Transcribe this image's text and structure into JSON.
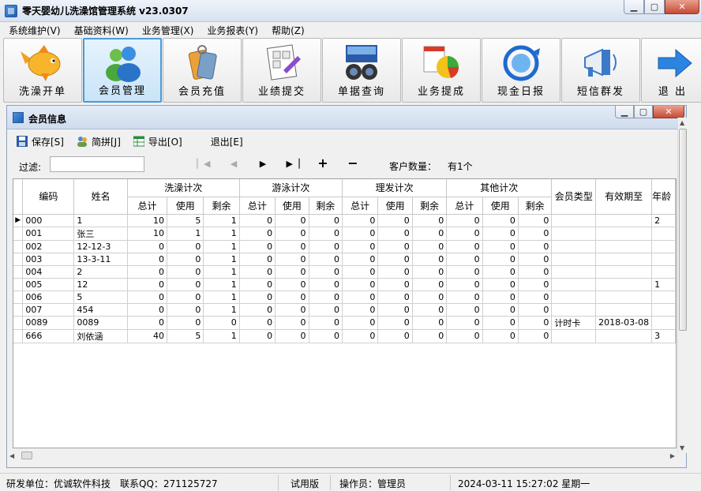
{
  "window": {
    "title": "零天婴幼儿洗澡馆管理系统  v23.0307"
  },
  "menu": [
    "系统维护(V)",
    "基础资料(W)",
    "业务管理(X)",
    "业务报表(Y)",
    "帮助(Z)"
  ],
  "toolbar": [
    {
      "label": "洗澡开单",
      "icon": "goldfish-icon"
    },
    {
      "label": "会员管理",
      "icon": "members-icon",
      "active": true
    },
    {
      "label": "会员充值",
      "icon": "recharge-tag-icon"
    },
    {
      "label": "业绩提交",
      "icon": "submit-sheet-icon"
    },
    {
      "label": "单据查询",
      "icon": "binoculars-icon"
    },
    {
      "label": "业务提成",
      "icon": "pie-chart-icon"
    },
    {
      "label": "现金日报",
      "icon": "refresh-globe-icon"
    },
    {
      "label": "短信群发",
      "icon": "megaphone-icon"
    },
    {
      "label": "退 出",
      "icon": "exit-arrow-icon"
    }
  ],
  "child": {
    "title": "会员信息",
    "buttons": {
      "save": "保存[S]",
      "pinyin": "简拼[J]",
      "export": "导出[O]",
      "exit": "退出[E]"
    },
    "filter_label": "过滤:",
    "filter_value": "",
    "nav_symbols": {
      "first": "▏◀",
      "prev": "◀",
      "next": "▶",
      "last": "▶▕",
      "add": "+",
      "delete": "−"
    },
    "count_label": "客户数量：",
    "count_value": "有1个"
  },
  "table": {
    "col_code": "编码",
    "col_name": "姓名",
    "groups": [
      "洗澡计次",
      "游泳计次",
      "理发计次",
      "其他计次"
    ],
    "sub": [
      "总计",
      "使用",
      "剩余"
    ],
    "col_type": "会员类型",
    "col_valid": "有效期至",
    "col_age": "年龄",
    "rows": [
      [
        "000",
        "1",
        "10",
        "5",
        "1",
        "0",
        "0",
        "0",
        "0",
        "0",
        "0",
        "0",
        "0",
        "0",
        "",
        "",
        "2"
      ],
      [
        "001",
        "张三",
        "10",
        "1",
        "1",
        "0",
        "0",
        "0",
        "0",
        "0",
        "0",
        "0",
        "0",
        "0",
        "",
        "",
        ""
      ],
      [
        "002",
        "12-12-3",
        "0",
        "0",
        "1",
        "0",
        "0",
        "0",
        "0",
        "0",
        "0",
        "0",
        "0",
        "0",
        "",
        "",
        ""
      ],
      [
        "003",
        "13-3-11",
        "0",
        "0",
        "1",
        "0",
        "0",
        "0",
        "0",
        "0",
        "0",
        "0",
        "0",
        "0",
        "",
        "",
        ""
      ],
      [
        "004",
        "2",
        "0",
        "0",
        "1",
        "0",
        "0",
        "0",
        "0",
        "0",
        "0",
        "0",
        "0",
        "0",
        "",
        "",
        ""
      ],
      [
        "005",
        "12",
        "0",
        "0",
        "1",
        "0",
        "0",
        "0",
        "0",
        "0",
        "0",
        "0",
        "0",
        "0",
        "",
        "",
        "1"
      ],
      [
        "006",
        "5",
        "0",
        "0",
        "1",
        "0",
        "0",
        "0",
        "0",
        "0",
        "0",
        "0",
        "0",
        "0",
        "",
        "",
        ""
      ],
      [
        "007",
        "454",
        "0",
        "0",
        "1",
        "0",
        "0",
        "0",
        "0",
        "0",
        "0",
        "0",
        "0",
        "0",
        "",
        "",
        ""
      ],
      [
        "0089",
        "0089",
        "0",
        "0",
        "0",
        "0",
        "0",
        "0",
        "0",
        "0",
        "0",
        "0",
        "0",
        "0",
        "计时卡",
        "2018-03-08",
        ""
      ],
      [
        "666",
        "刘依涵",
        "40",
        "5",
        "1",
        "0",
        "0",
        "0",
        "0",
        "0",
        "0",
        "0",
        "0",
        "0",
        "",
        "",
        "3"
      ]
    ]
  },
  "status": {
    "dev": "研发单位：优诚软件科技",
    "qq": "联系QQ：271125727",
    "edition": "试用版",
    "operator": "操作员：管理员",
    "datetime": "2024-03-11 15:27:02 星期一"
  }
}
